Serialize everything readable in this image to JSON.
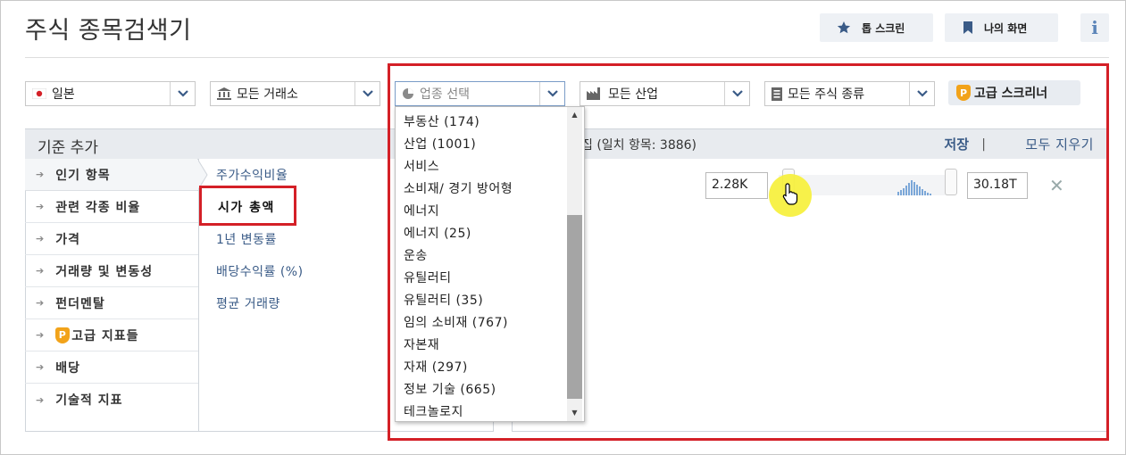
{
  "app": {
    "title": "주식 종목검색기",
    "top_screen_label": "톱 스크린",
    "my_screen_label": "나의 화면",
    "info_label": "i"
  },
  "filters": {
    "country": "일본",
    "exchange": "모든 거래소",
    "sector_placeholder": "업종 선택",
    "industry": "모든 산업",
    "stock_type": "모든 주식 종류",
    "advanced_screener": "고급 스크리너"
  },
  "criteria": {
    "header": "기준 추가",
    "categories": [
      {
        "label": "인기 항목"
      },
      {
        "label": "관련 각종 비율"
      },
      {
        "label": "가격"
      },
      {
        "label": "거래량 및 변동성"
      },
      {
        "label": "펀더멘탈"
      },
      {
        "label": "고급 지표들"
      },
      {
        "label": "배당"
      },
      {
        "label": "기술적 지표"
      }
    ],
    "subitems": [
      {
        "label": "주가수익비율"
      },
      {
        "label": "시가 총액"
      },
      {
        "label": "1년 변동률"
      },
      {
        "label": "배당수익률 (%)"
      },
      {
        "label": "평균 거래량"
      }
    ]
  },
  "results": {
    "header": "집 (일치 항목: 3886)",
    "save": "저장",
    "separator": "|",
    "clear_all": "모두 지우기",
    "min_value": "2.28K",
    "max_value": "30.18T",
    "remove": "✕"
  },
  "sector_dropdown": {
    "items": [
      "부동산 (174)",
      "산업 (1001)",
      "서비스",
      "소비재/ 경기 방어형",
      "에너지",
      "에너지 (25)",
      "운송",
      "유틸러티",
      "유틸러티 (35)",
      "임의 소비재 (767)",
      "자본재",
      "자재 (297)",
      "정보 기술 (665)",
      "테크놀로지"
    ]
  },
  "colors": {
    "highlight_red": "#d42027",
    "link_blue": "#3a5b87",
    "header_bg": "#e8ebef",
    "premium_orange": "#f2a31a",
    "cursor_yellow": "#f7f040"
  },
  "icons": {
    "country": "japan-flag-icon",
    "exchange": "bank-icon",
    "sector": "pie-chart-icon",
    "industry": "factory-icon",
    "stock_type": "document-icon",
    "premium": "p-badge-icon",
    "top_screen": "star-icon",
    "my_screen": "bookmark-icon"
  }
}
